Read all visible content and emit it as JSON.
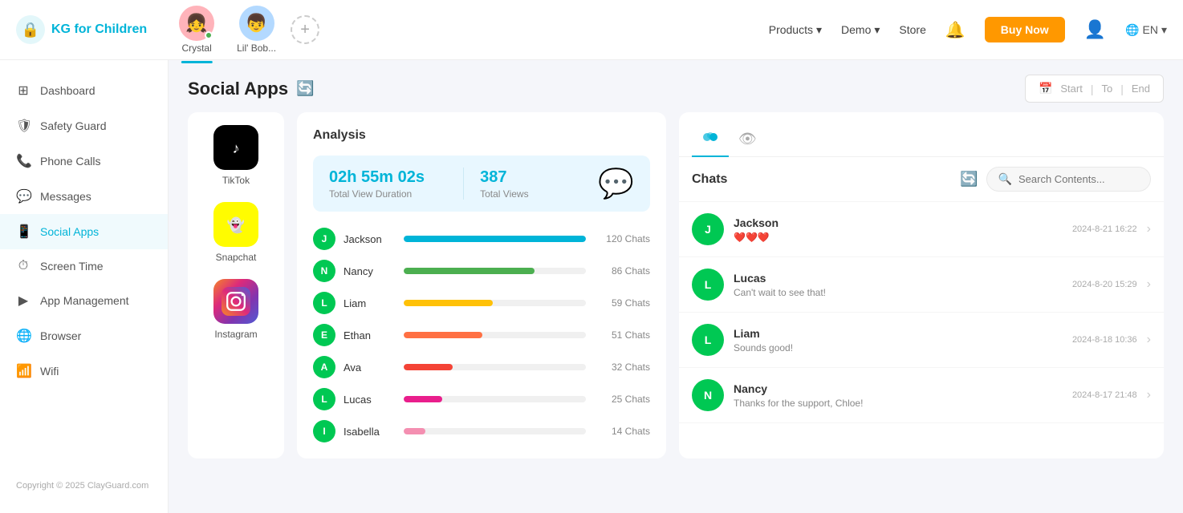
{
  "app": {
    "name_prefix": "KG for ",
    "name_suffix": "Children"
  },
  "topnav": {
    "profiles": [
      {
        "id": "crystal",
        "name": "Crystal",
        "emoji": "👧",
        "bg": "#ffb3ba",
        "active": true
      },
      {
        "id": "bob",
        "name": "Lil' Bob...",
        "emoji": "👦",
        "bg": "#b3d9ff",
        "active": false
      }
    ],
    "add_label": "+",
    "nav_links": [
      {
        "id": "products",
        "label": "Products",
        "has_arrow": true
      },
      {
        "id": "demo",
        "label": "Demo",
        "has_arrow": true
      },
      {
        "id": "store",
        "label": "Store",
        "has_arrow": false
      }
    ],
    "buy_button_label": "Buy Now",
    "lang_label": "EN"
  },
  "sidebar": {
    "items": [
      {
        "id": "dashboard",
        "label": "Dashboard",
        "icon": "⊞"
      },
      {
        "id": "safety-guard",
        "label": "Safety Guard",
        "icon": "🛡"
      },
      {
        "id": "phone-calls",
        "label": "Phone Calls",
        "icon": "📞"
      },
      {
        "id": "messages",
        "label": "Messages",
        "icon": "💬"
      },
      {
        "id": "social-apps",
        "label": "Social Apps",
        "icon": "📱",
        "active": true
      },
      {
        "id": "screen-time",
        "label": "Screen Time",
        "icon": "⏱"
      },
      {
        "id": "app-management",
        "label": "App Management",
        "icon": "▶"
      },
      {
        "id": "browser",
        "label": "Browser",
        "icon": "🌐"
      },
      {
        "id": "wifi",
        "label": "Wifi",
        "icon": "📶"
      }
    ],
    "footer": "Copyright © 2025 ClayGuard.com"
  },
  "page": {
    "title": "Social Apps",
    "refresh_icon": "🔄",
    "date_filter": {
      "icon": "📅",
      "start_label": "Start",
      "to_label": "To",
      "end_label": "End"
    }
  },
  "apps": [
    {
      "id": "tiktok",
      "name": "TikTok",
      "icon": "♪",
      "bg_class": "app-icon-tiktok"
    },
    {
      "id": "snapchat",
      "name": "Snapchat",
      "icon": "👻",
      "bg_class": "app-icon-snapchat"
    },
    {
      "id": "instagram",
      "name": "Instagram",
      "icon": "📷",
      "bg_class": "app-icon-instagram"
    }
  ],
  "analysis": {
    "title": "Analysis",
    "total_duration": "02h 55m 02s",
    "total_duration_label": "Total View Duration",
    "total_views": "387",
    "total_views_label": "Total Views",
    "chart_data": [
      {
        "name": "Jackson",
        "count": "120 Chats",
        "pct": 100,
        "bar_class": "bar-blue",
        "initial": "J"
      },
      {
        "name": "Nancy",
        "count": "86 Chats",
        "pct": 72,
        "bar_class": "bar-green",
        "initial": "N"
      },
      {
        "name": "Liam",
        "count": "59 Chats",
        "pct": 49,
        "bar_class": "bar-yellow",
        "initial": "L"
      },
      {
        "name": "Ethan",
        "count": "51 Chats",
        "pct": 43,
        "bar_class": "bar-orange",
        "initial": "E"
      },
      {
        "name": "Ava",
        "count": "32 Chats",
        "pct": 27,
        "bar_class": "bar-red",
        "initial": "A"
      },
      {
        "name": "Lucas",
        "count": "25 Chats",
        "pct": 21,
        "bar_class": "bar-pink",
        "initial": "L"
      },
      {
        "name": "Isabella",
        "count": "14 Chats",
        "pct": 12,
        "bar_class": "bar-lightpink",
        "initial": "I"
      }
    ]
  },
  "chats": {
    "title": "Chats",
    "search_placeholder": "Search Contents...",
    "list": [
      {
        "name": "Jackson",
        "preview": "❤️❤️❤️",
        "time": "2024-8-21 16:22",
        "initial": "J",
        "has_hearts": true
      },
      {
        "name": "Lucas",
        "preview": "Can't wait to see that!",
        "time": "2024-8-20 15:29",
        "initial": "L"
      },
      {
        "name": "Liam",
        "preview": "Sounds good!",
        "time": "2024-8-18 10:36",
        "initial": "L"
      },
      {
        "name": "Nancy",
        "preview": "Thanks for the support, Chloe!",
        "time": "2024-8-17 21:48",
        "initial": "N"
      }
    ]
  }
}
